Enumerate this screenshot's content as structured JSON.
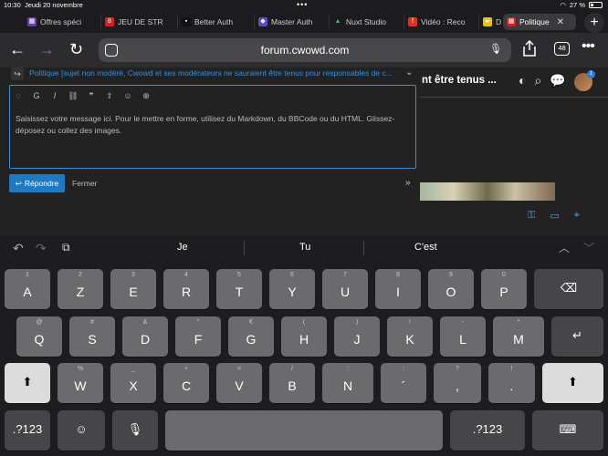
{
  "status": {
    "time": "10:30",
    "date": "Jeudi 20 novembre",
    "battery": "27 %"
  },
  "tabs": [
    {
      "label": "Offres spéci",
      "fav_color": "#6b3fa0",
      "fav": "▦"
    },
    {
      "label": "JEU DE STR",
      "fav_color": "#d02020",
      "fav": "8"
    },
    {
      "label": "Better Auth",
      "fav_color": "#111111",
      "fav": "▪"
    },
    {
      "label": "Master Auth",
      "fav_color": "#5a4ad0",
      "fav": "◆"
    },
    {
      "label": "Nuxt Studio",
      "fav_color": "#1c1c1e",
      "fav": "▲"
    },
    {
      "label": "Vidéo : Reco",
      "fav_color": "#e03020",
      "fav": "f"
    },
    {
      "label": "D",
      "fav_color": "#f0c000",
      "fav": "▰"
    },
    {
      "label": "Politique",
      "fav_color": "#d02020",
      "fav": "▦"
    }
  ],
  "toolbar": {
    "url": "forum.cwowd.com",
    "tab_count": "48"
  },
  "forum": {
    "topic_title": "nt être tenus ...",
    "reply_to": "Politique [sujet non modéré, Cwowd et ses modérateurs ne sauraient être tenus pour responsables de c...",
    "editor_placeholder": "Saisissez votre message ici. Pour le mettre en forme, utilisez du Markdown, du BBCode ou du HTML. Glissez-déposez ou collez des images.",
    "reply_button": "Répondre",
    "close_label": "Fermer",
    "notification_count": "1"
  },
  "keyboard": {
    "suggestions": [
      "Je",
      "Tu",
      "C'est"
    ],
    "row1": [
      {
        "alt": "1",
        "main": "A"
      },
      {
        "alt": "2",
        "main": "Z"
      },
      {
        "alt": "3",
        "main": "E"
      },
      {
        "alt": "4",
        "main": "R"
      },
      {
        "alt": "5",
        "main": "T"
      },
      {
        "alt": "6",
        "main": "Y"
      },
      {
        "alt": "7",
        "main": "U"
      },
      {
        "alt": "8",
        "main": "I"
      },
      {
        "alt": "9",
        "main": "O"
      },
      {
        "alt": "0",
        "main": "P"
      }
    ],
    "row2": [
      {
        "alt": "@",
        "main": "Q"
      },
      {
        "alt": "#",
        "main": "S"
      },
      {
        "alt": "&",
        "main": "D"
      },
      {
        "alt": "\"",
        "main": "F"
      },
      {
        "alt": "€",
        "main": "G"
      },
      {
        "alt": "(",
        "main": "H"
      },
      {
        "alt": ")",
        "main": "J"
      },
      {
        "alt": "!",
        "main": "K"
      },
      {
        "alt": "-",
        "main": "L"
      },
      {
        "alt": "*",
        "main": "M"
      }
    ],
    "row3": [
      {
        "alt": "%",
        "main": "W"
      },
      {
        "alt": "_",
        "main": "X"
      },
      {
        "alt": "+",
        "main": "C"
      },
      {
        "alt": "=",
        "main": "V"
      },
      {
        "alt": "/",
        "main": "B"
      },
      {
        "alt": ";",
        "main": "N"
      },
      {
        "alt": ":",
        "main": "´"
      },
      {
        "alt": "?",
        "main": ","
      },
      {
        "alt": "!",
        "main": "."
      }
    ],
    "numbers_label": ".?123"
  }
}
